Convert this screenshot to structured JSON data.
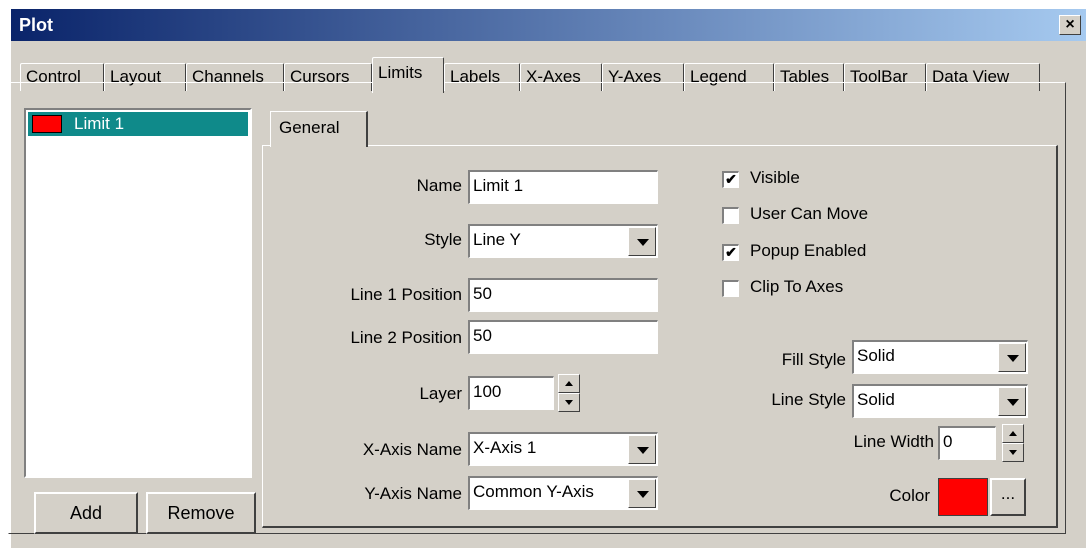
{
  "window": {
    "title": "Plot",
    "close_glyph": "×"
  },
  "tabs": [
    "Control",
    "Layout",
    "Channels",
    "Cursors",
    "Limits",
    "Labels",
    "X-Axes",
    "Y-Axes",
    "Legend",
    "Tables",
    "ToolBar",
    "Data View"
  ],
  "active_tab": "Limits",
  "limits_list": {
    "items": [
      {
        "label": "Limit 1",
        "color": "#ff0000"
      }
    ]
  },
  "buttons": {
    "add": "Add",
    "remove": "Remove",
    "dots": "..."
  },
  "general_tab": "General",
  "fields": {
    "name_label": "Name",
    "name_value": "Limit 1",
    "style_label": "Style",
    "style_value": "Line Y",
    "line1_label": "Line 1 Position",
    "line1_value": "50",
    "line2_label": "Line 2 Position",
    "line2_value": "50",
    "layer_label": "Layer",
    "layer_value": "100",
    "xaxis_label": "X-Axis Name",
    "xaxis_value": "X-Axis 1",
    "yaxis_label": "Y-Axis Name",
    "yaxis_value": "Common Y-Axis",
    "fill_style_label": "Fill Style",
    "fill_style_value": "Solid",
    "line_style_label": "Line Style",
    "line_style_value": "Solid",
    "line_width_label": "Line Width",
    "line_width_value": "0",
    "color_label": "Color",
    "color_value": "#ff0000"
  },
  "checkboxes": {
    "visible": {
      "label": "Visible",
      "checked": true
    },
    "user_can_move": {
      "label": "User Can Move",
      "checked": false
    },
    "popup_enabled": {
      "label": "Popup Enabled",
      "checked": true
    },
    "clip_to_axes": {
      "label": "Clip To Axes",
      "checked": false
    }
  },
  "check_glyph": "✔"
}
